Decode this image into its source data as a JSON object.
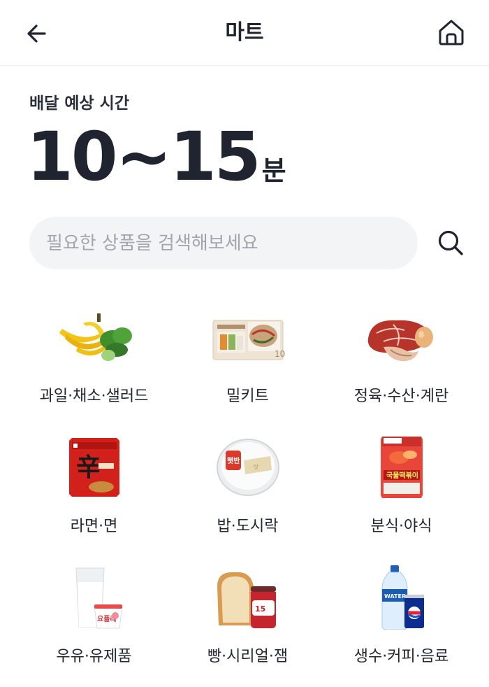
{
  "header": {
    "title": "마트",
    "back_icon": "arrow-left-icon",
    "home_icon": "home-icon"
  },
  "delivery": {
    "label": "배달 예상 시간",
    "value": "10~15",
    "unit": "분"
  },
  "search": {
    "placeholder": "필요한 상품을 검색해보세요",
    "icon": "search-icon"
  },
  "categories": [
    {
      "label": "과일·채소·샐러드",
      "icon": "banana-greens-icon"
    },
    {
      "label": "밀키트",
      "icon": "meal-kit-icon"
    },
    {
      "label": "정육·수산·계란",
      "icon": "meat-shrimp-egg-icon"
    },
    {
      "label": "라면·면",
      "icon": "ramen-pack-icon"
    },
    {
      "label": "밥·도시락",
      "icon": "rice-bowl-icon"
    },
    {
      "label": "분식·야식",
      "icon": "tteokbokki-pack-icon"
    },
    {
      "label": "우유·유제품",
      "icon": "milk-yogurt-icon"
    },
    {
      "label": "빵·시리얼·잼",
      "icon": "bread-jam-icon"
    },
    {
      "label": "생수·커피·음료",
      "icon": "water-soda-icon"
    }
  ]
}
